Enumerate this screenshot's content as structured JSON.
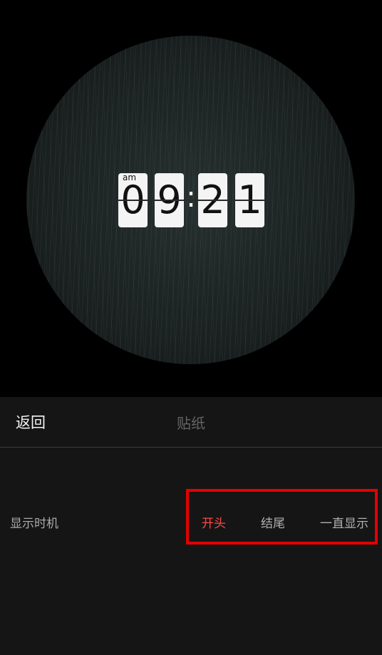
{
  "preview": {
    "clock": {
      "ampm": "am",
      "h1": "0",
      "h2": "9",
      "separator": ":",
      "m1": "2",
      "m2": "1"
    }
  },
  "header": {
    "back_label": "返回",
    "title": "贴纸"
  },
  "timing": {
    "label": "显示时机",
    "options": [
      "开头",
      "结尾",
      "一直显示"
    ],
    "selected": "开头"
  },
  "colors": {
    "selected": "#ff4a4a",
    "highlight_box": "#e50000",
    "panel_bg": "#151515"
  }
}
